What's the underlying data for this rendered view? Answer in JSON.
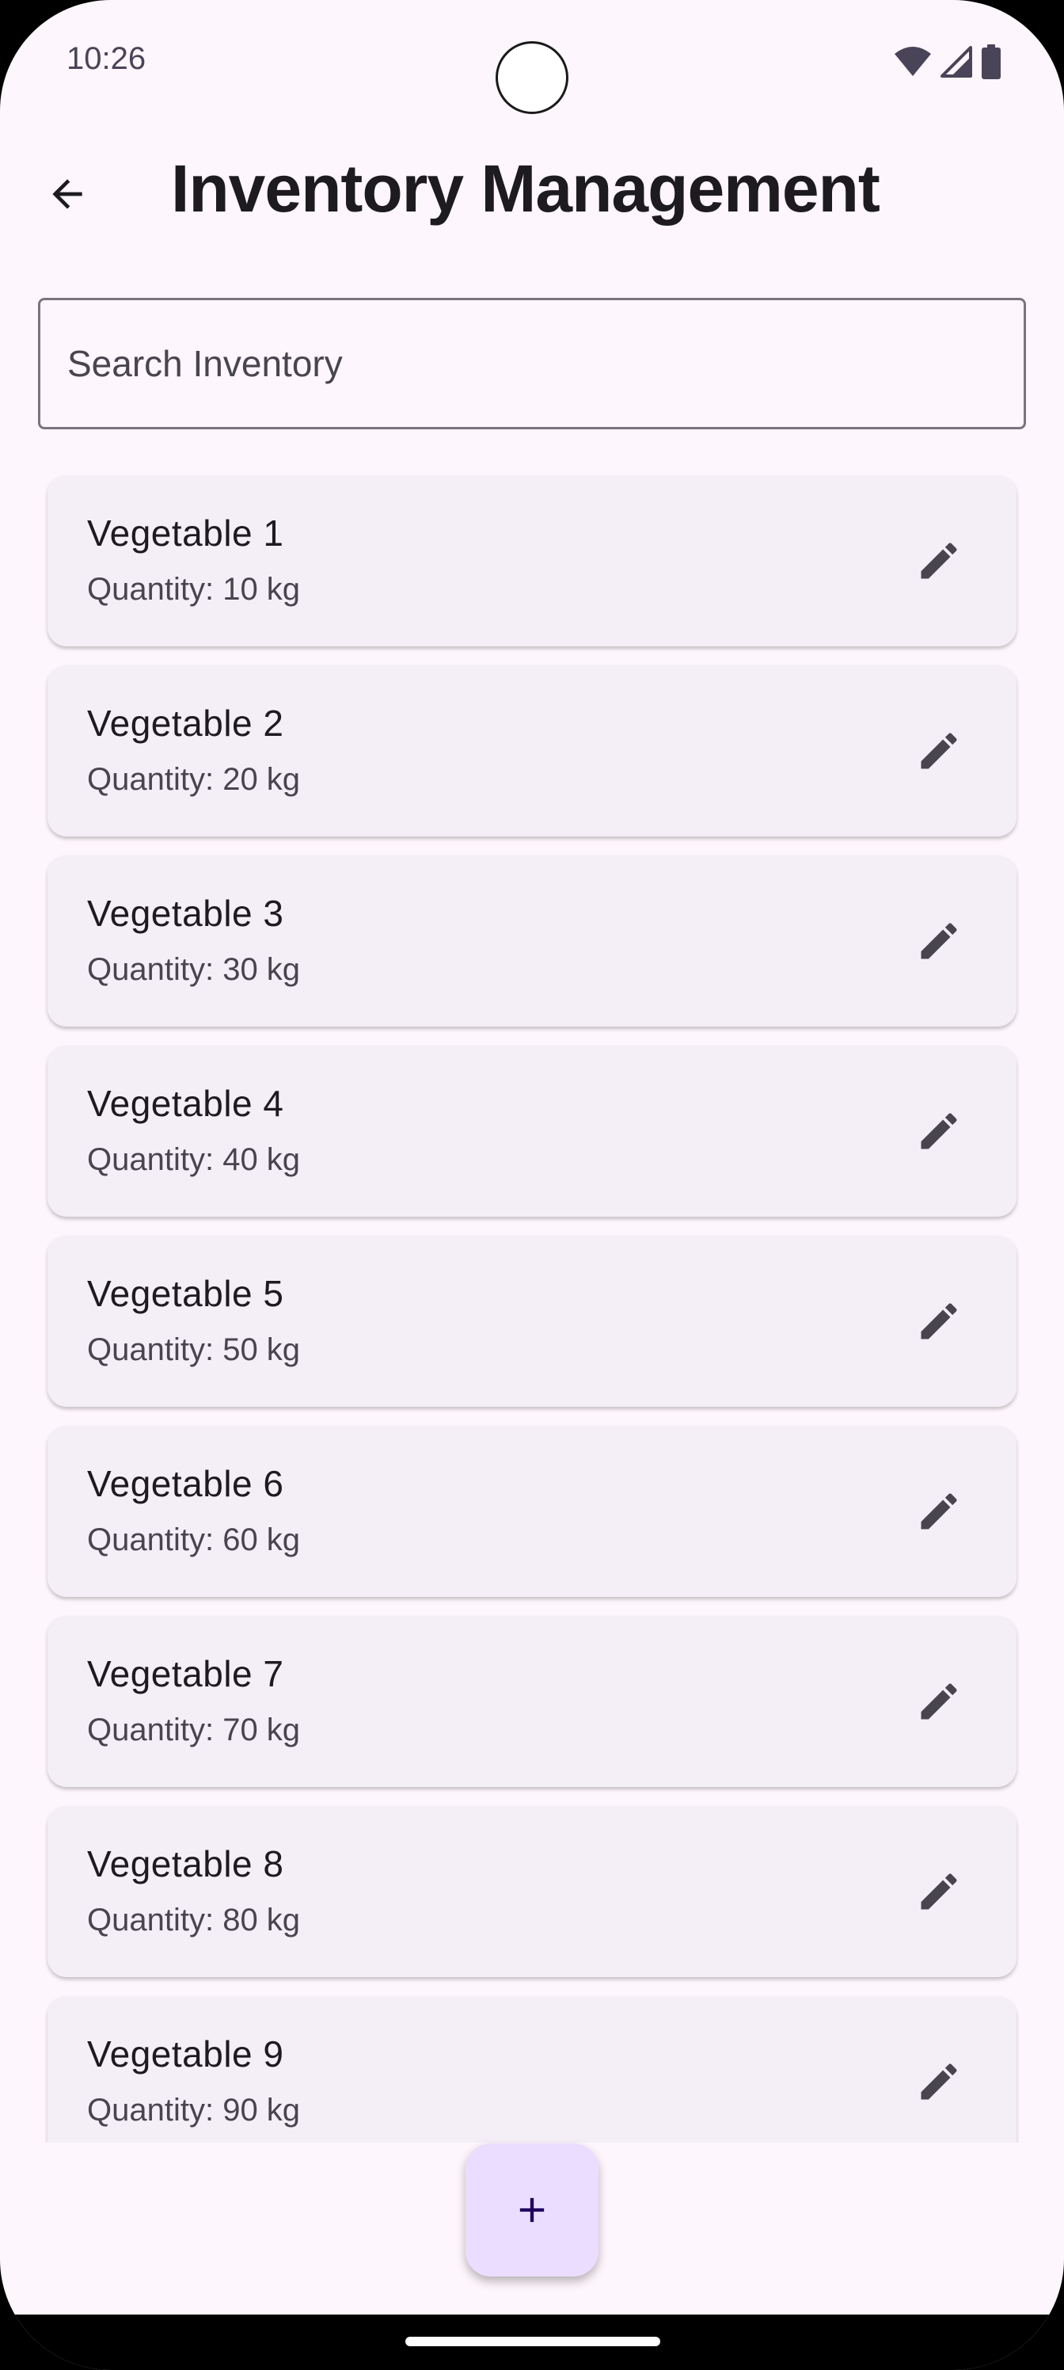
{
  "status_bar": {
    "time": "10:26",
    "icons": [
      "wifi-icon",
      "signal-icon",
      "battery-icon"
    ]
  },
  "app_bar": {
    "back_icon": "arrow-back-icon",
    "title": "Inventory Management"
  },
  "search": {
    "placeholder": "Search Inventory",
    "value": ""
  },
  "inventory": {
    "items": [
      {
        "name": "Vegetable 1",
        "quantity": "Quantity: 10 kg"
      },
      {
        "name": "Vegetable 2",
        "quantity": "Quantity: 20 kg"
      },
      {
        "name": "Vegetable 3",
        "quantity": "Quantity: 30 kg"
      },
      {
        "name": "Vegetable 4",
        "quantity": "Quantity: 40 kg"
      },
      {
        "name": "Vegetable 5",
        "quantity": "Quantity: 50 kg"
      },
      {
        "name": "Vegetable 6",
        "quantity": "Quantity: 60 kg"
      },
      {
        "name": "Vegetable 7",
        "quantity": "Quantity: 70 kg"
      },
      {
        "name": "Vegetable 8",
        "quantity": "Quantity: 80 kg"
      },
      {
        "name": "Vegetable 9",
        "quantity": "Quantity: 90 kg"
      }
    ],
    "edit_icon": "edit-pencil-icon"
  },
  "fab": {
    "icon": "add-icon"
  },
  "colors": {
    "background": "#fdf6fc",
    "card": "#f4eff6",
    "fab": "#eaddff",
    "text_primary": "#1d1b20",
    "text_secondary": "#49454f",
    "outline": "#79747e"
  }
}
